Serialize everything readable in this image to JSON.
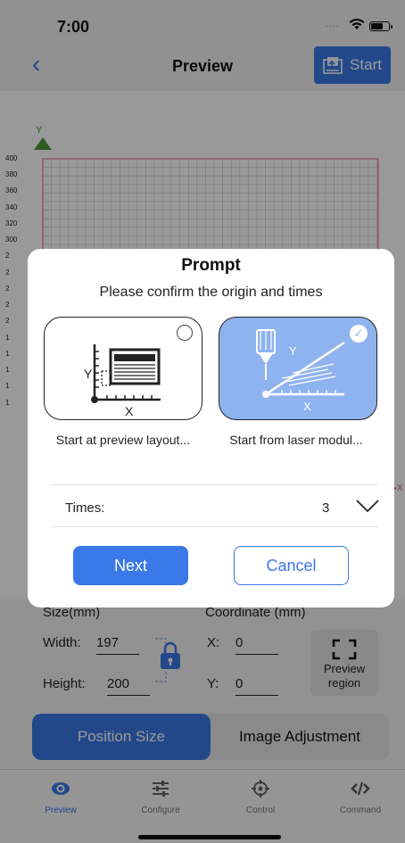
{
  "status_bar": {
    "time": "7:00",
    "signal_dots": "....",
    "wifi_icon": "wifi-icon",
    "battery_icon": "battery-icon"
  },
  "navbar": {
    "back_icon": "chevron-left-icon",
    "title": "Preview",
    "start_label": "Start",
    "start_icon": "image-upload-icon"
  },
  "grid": {
    "y_axis_label": "Y",
    "x_axis_label": "X",
    "y_ticks": [
      "400",
      "380",
      "360",
      "340",
      "320",
      "300",
      "2",
      "2",
      "2",
      "2",
      "2",
      "1",
      "1",
      "1",
      "1",
      "1"
    ],
    "accent_color": "#e06080",
    "axis_color": "#4b9a3a"
  },
  "dialog": {
    "title": "Prompt",
    "message": "Please confirm the origin and times",
    "options": [
      {
        "caption": "Start at preview layout...",
        "selected": false,
        "axis_y": "Y",
        "axis_x": "X"
      },
      {
        "caption": "Start from laser modul...",
        "selected": true,
        "axis_y": "Y",
        "axis_x": "X"
      }
    ],
    "times_label": "Times:",
    "times_value": "3",
    "next_label": "Next",
    "cancel_label": "Cancel"
  },
  "size_panel": {
    "size_label": "Size(mm)",
    "coord_label": "Coordinate (mm)",
    "width_label": "Width:",
    "width_value": "197",
    "height_label": "Height:",
    "height_value": "200",
    "x_label": "X:",
    "x_value": "0",
    "y_label": "Y:",
    "y_value": "0",
    "preview_region_label": "Preview region"
  },
  "segment": {
    "tabs": [
      "Position Size",
      "Image Adjustment"
    ],
    "active_index": 0
  },
  "tabbar": {
    "items": [
      {
        "label": "Preview",
        "icon": "eye-icon",
        "active": true
      },
      {
        "label": "Configure",
        "icon": "sliders-icon",
        "active": false
      },
      {
        "label": "Control",
        "icon": "crosshair-icon",
        "active": false
      },
      {
        "label": "Command",
        "icon": "code-icon",
        "active": false
      }
    ]
  },
  "colors": {
    "accent": "#3b78e7",
    "selected_card": "#8fb3ee"
  }
}
